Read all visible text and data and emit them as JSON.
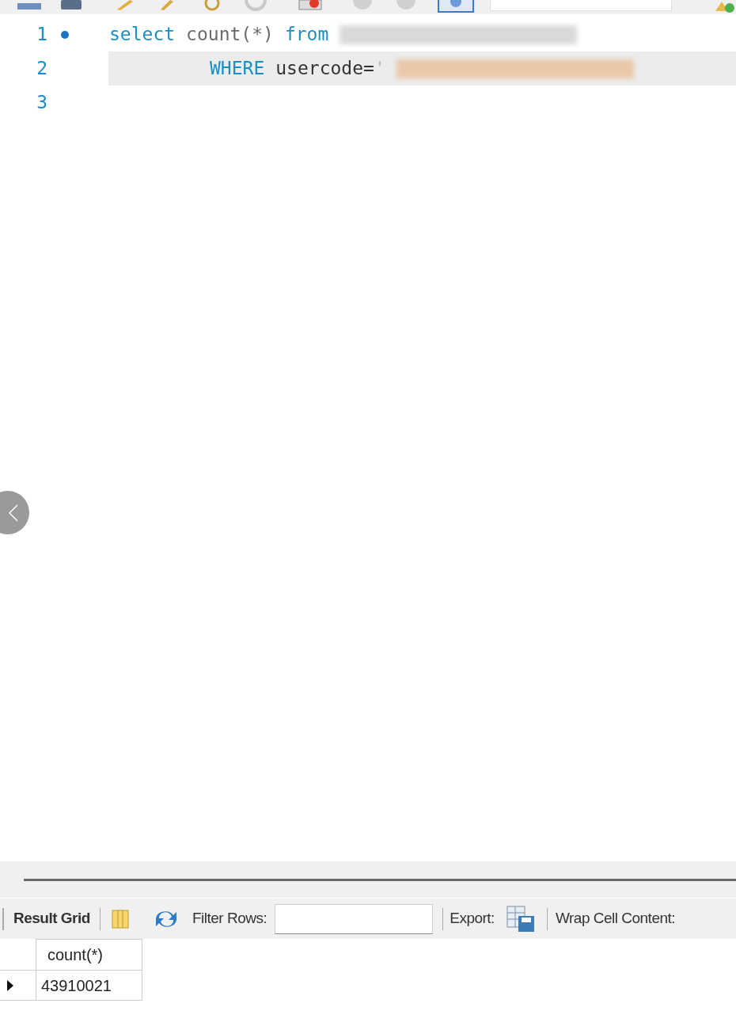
{
  "editor": {
    "lines": [
      {
        "number": "1",
        "breakpoint": true,
        "current": false,
        "indent": false,
        "tokens": [
          {
            "kind": "keyword",
            "text": "select"
          },
          {
            "kind": "function",
            "text": "count(*)"
          },
          {
            "kind": "keyword",
            "text": "from"
          },
          {
            "kind": "redacted",
            "color": "#d9d9d9"
          }
        ]
      },
      {
        "number": "2",
        "breakpoint": false,
        "current": true,
        "indent": true,
        "tokens": [
          {
            "kind": "keyword",
            "text": "WHERE"
          },
          {
            "kind": "plain",
            "text": "usercode="
          },
          {
            "kind": "string",
            "text": "'"
          },
          {
            "kind": "redacted",
            "color": "#e9c7a9"
          }
        ]
      },
      {
        "number": "3",
        "breakpoint": false,
        "current": false
      }
    ]
  },
  "results": {
    "tab": "Result Grid",
    "filter_label": "Filter Rows:",
    "export_label": "Export:",
    "wrap_label": "Wrap Cell Content:",
    "grid": {
      "columns": [
        "count(*)"
      ],
      "rows": [
        {
          "current": true,
          "cells": [
            "43910021"
          ]
        }
      ]
    }
  }
}
